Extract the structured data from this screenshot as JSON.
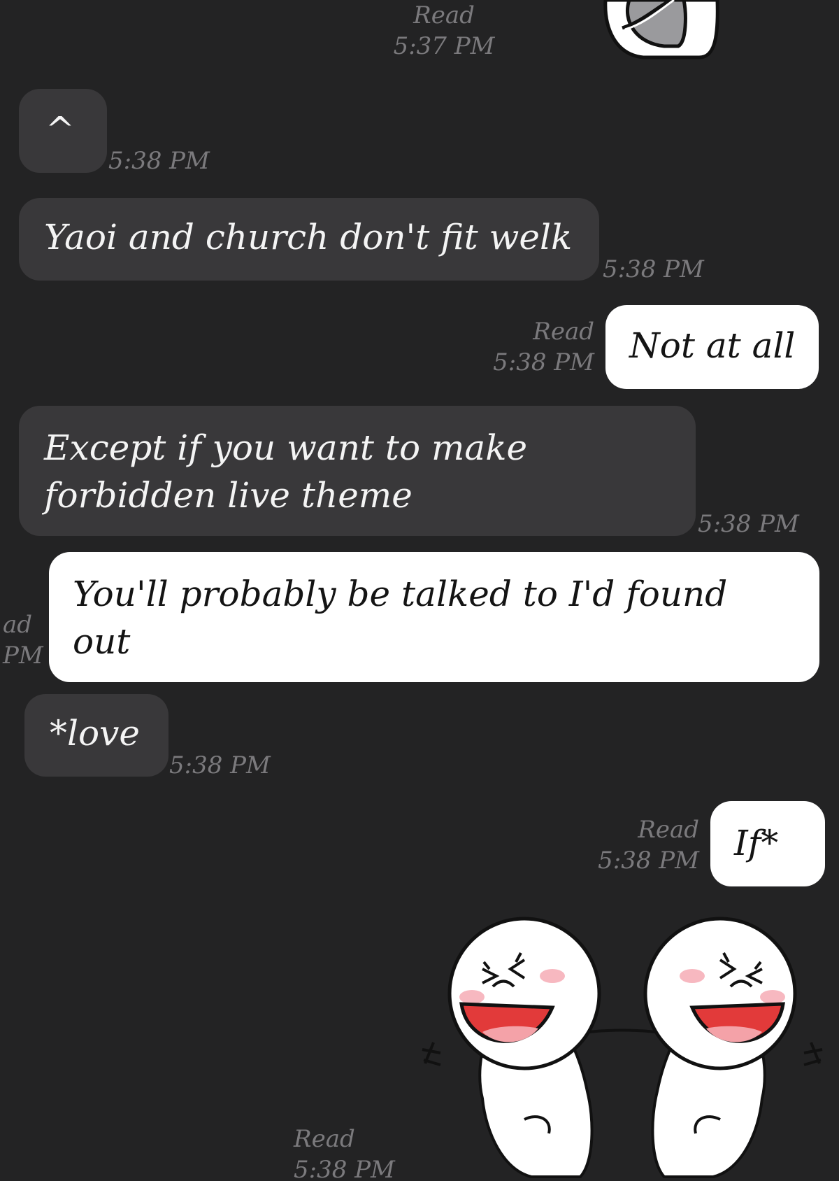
{
  "messages": [
    {
      "side": "outgoing",
      "read_label": "Read",
      "time": "5:37 PM"
    },
    {
      "side": "incoming",
      "text": "^",
      "time": "5:38 PM"
    },
    {
      "side": "incoming",
      "text": "Yaoi and church don't fit welk",
      "time": "5:38 PM"
    },
    {
      "side": "outgoing",
      "text": "Not at all",
      "read_label": "Read",
      "time": "5:38 PM"
    },
    {
      "side": "incoming",
      "text": "Except if you want to make forbidden live theme",
      "time": "5:38 PM"
    },
    {
      "side": "outgoing",
      "text": "You'll probably be talked to I'd found out",
      "read_label": "ad",
      "time": "PM"
    },
    {
      "side": "incoming",
      "text": "*love",
      "time": "5:38 PM"
    },
    {
      "side": "outgoing",
      "text": "If*",
      "read_label": "Read",
      "time": "5:38 PM"
    },
    {
      "side": "outgoing",
      "sticker": "laughing-twins-sticker",
      "read_label": "Read",
      "time": "5:38 PM"
    }
  ],
  "colors": {
    "background": "#232324",
    "incoming_bubble": "#39383a",
    "outgoing_bubble": "#ffffff",
    "meta_text": "#7b7a7d"
  }
}
